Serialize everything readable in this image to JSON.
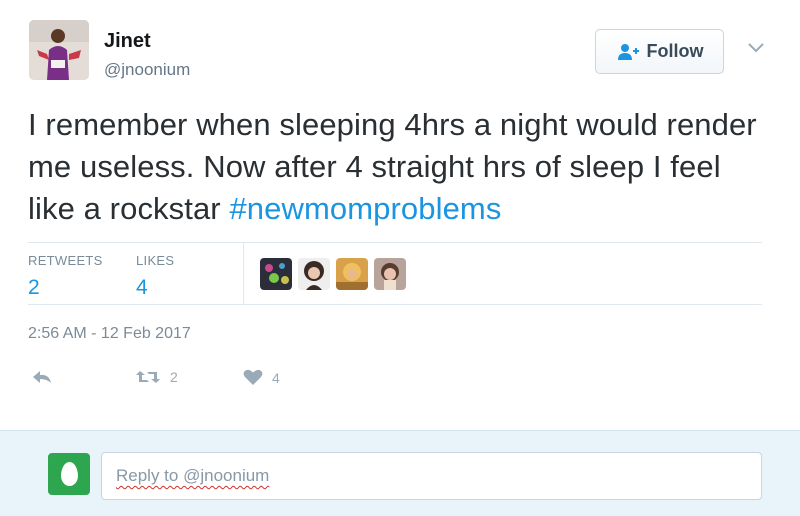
{
  "user": {
    "name": "Jinet",
    "handle": "@jnoonium"
  },
  "header": {
    "follow_label": "Follow"
  },
  "tweet": {
    "text_plain": "I remember when sleeping 4hrs a night would render me useless. Now after 4 straight hrs of sleep I feel like a rockstar ",
    "hashtag": "#newmomproblems"
  },
  "stats": {
    "retweets_label": "RETWEETS",
    "retweets_value": "2",
    "likes_label": "LIKES",
    "likes_value": "4"
  },
  "timestamp": "2:56 AM - 12 Feb 2017",
  "actions": {
    "retweet_count": "2",
    "like_count": "4"
  },
  "reply": {
    "placeholder": "Reply to @jnoonium"
  },
  "colors": {
    "link": "#1b95e0",
    "reply_bg": "#e9f3fa",
    "egg_avatar": "#2ea650"
  },
  "icons": [
    "follow-user-icon",
    "chevron-down-icon",
    "reply-icon",
    "retweet-icon",
    "heart-icon",
    "egg-avatar-icon"
  ]
}
